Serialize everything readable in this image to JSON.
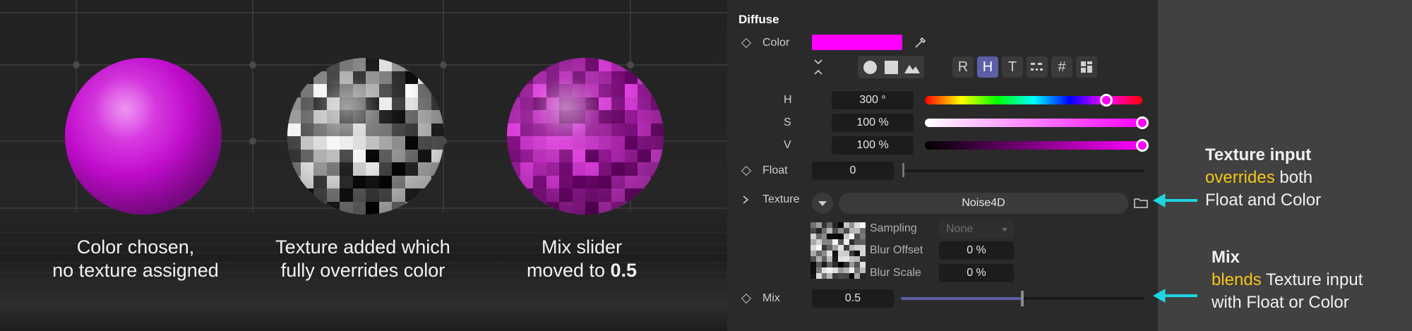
{
  "viewport": {
    "captions": [
      {
        "line1": "Color chosen,",
        "line2": "no texture assigned"
      },
      {
        "line1": "Texture added which",
        "line2": "fully overrides color"
      },
      {
        "line1": "Mix slider",
        "line2_prefix": "moved to ",
        "line2_bold": "0.5"
      }
    ],
    "colors": {
      "magenta": "#ff00ff"
    }
  },
  "panel": {
    "section_title": "Diffuse",
    "color": {
      "label": "Color",
      "swatch": "#ff00ff"
    },
    "color_modes": [
      "R",
      "H",
      "T",
      "#"
    ],
    "active_mode": "H",
    "hsv": [
      {
        "label": "H",
        "value": "300 °",
        "level": 0.833
      },
      {
        "label": "S",
        "value": "100 %",
        "level": 1.0
      },
      {
        "label": "V",
        "value": "100 %",
        "level": 1.0
      }
    ],
    "float": {
      "label": "Float",
      "value": "0",
      "level": 0.0
    },
    "texture": {
      "label": "Texture",
      "name": "Noise4D"
    },
    "sampling": {
      "label": "Sampling",
      "value": "None"
    },
    "blur_offset": {
      "label": "Blur Offset",
      "value": "0 %"
    },
    "blur_scale": {
      "label": "Blur Scale",
      "value": "0 %"
    },
    "mix": {
      "label": "Mix",
      "value": "0.5",
      "level": 0.5
    },
    "accent": "#5b5fa6"
  },
  "annotations": {
    "texture": {
      "heading": "Texture input",
      "highlight": "overrides",
      "rest1": " both",
      "line3": "Float and Color"
    },
    "mix": {
      "heading": "Mix",
      "highlight": "blends",
      "rest1": " Texture input",
      "line3": "with Float or Color"
    },
    "arrow_color": "#1ed5e0",
    "highlight_color": "#f5c518"
  }
}
